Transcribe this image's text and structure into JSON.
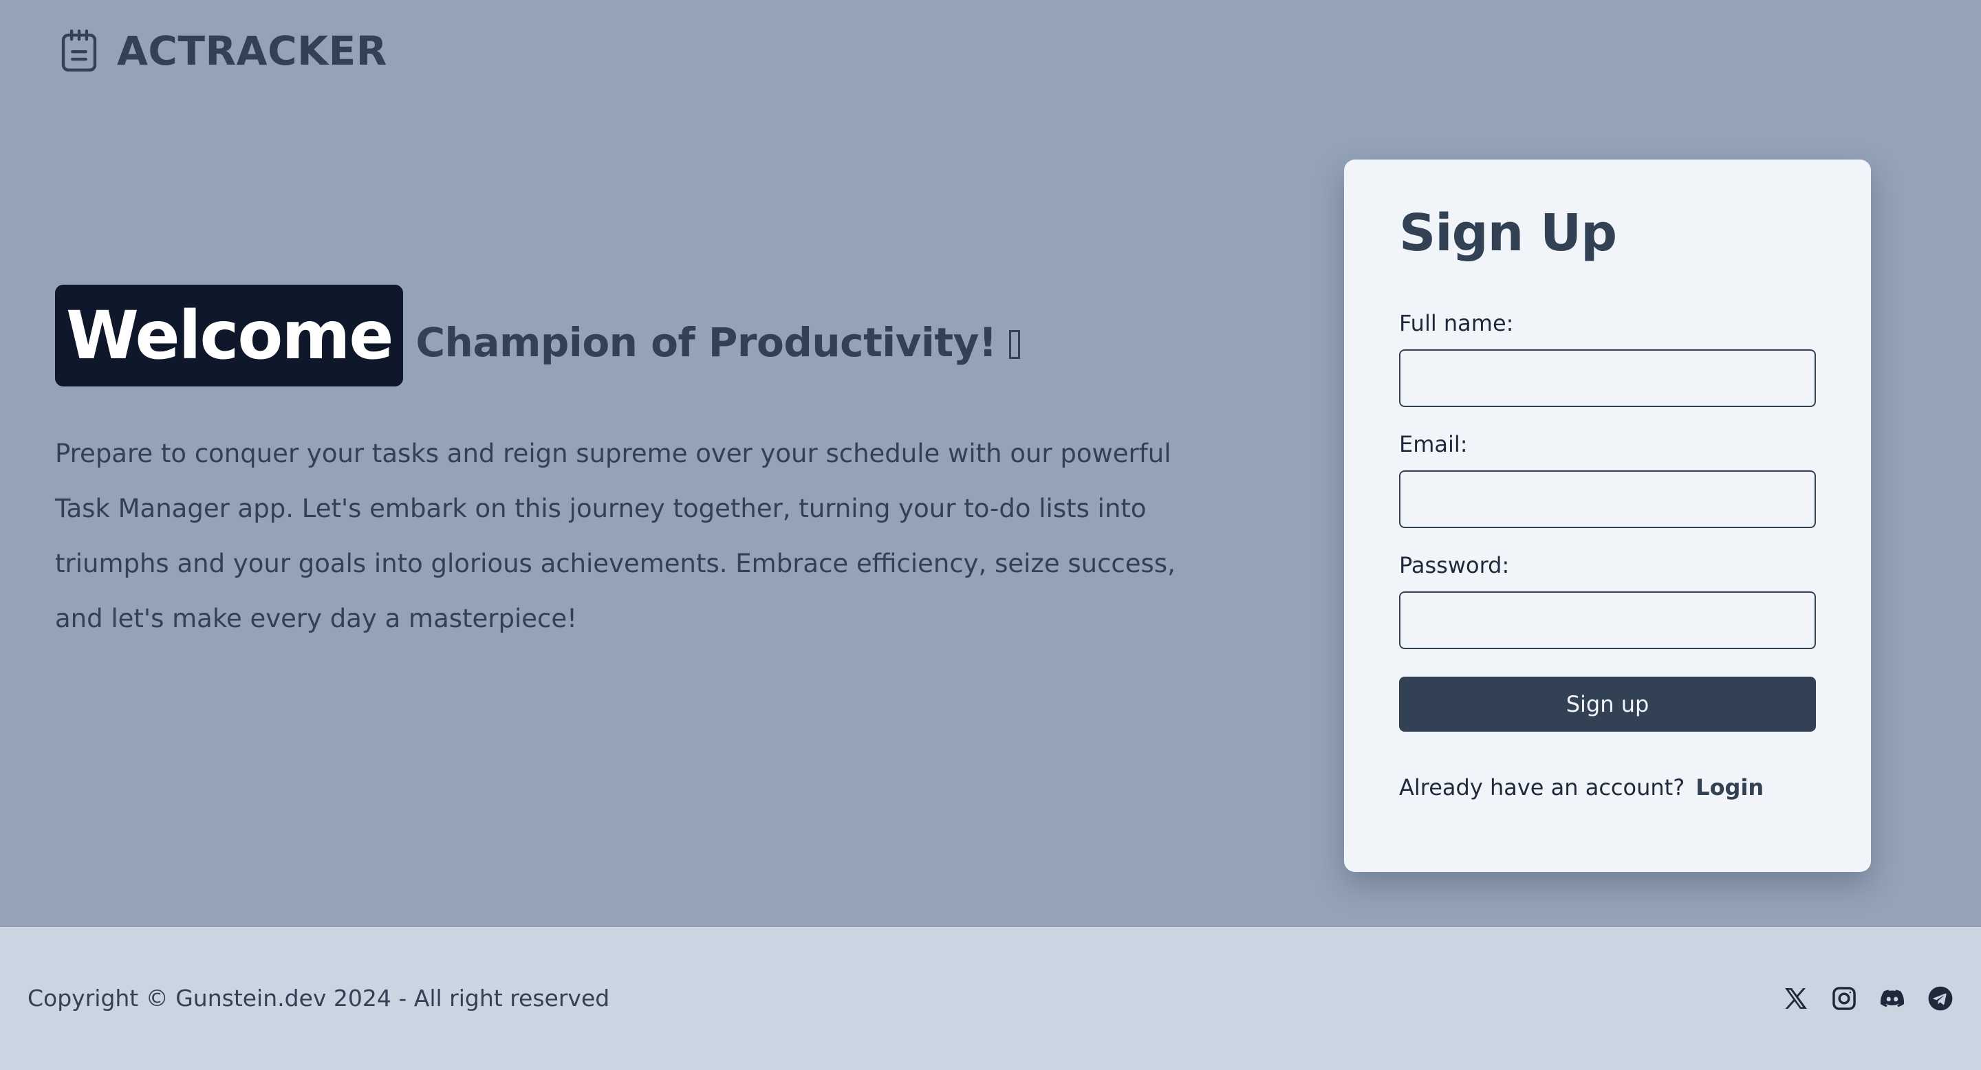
{
  "header": {
    "brand": "ACTRACKER",
    "logo_icon": "clipboard-icon"
  },
  "hero": {
    "welcome": "Welcome",
    "headline": "Champion of Productivity!",
    "intro": "Prepare to conquer your tasks and reign supreme over your schedule with our powerful Task Manager app. Let's embark on this journey together, turning your to-do lists into triumphs and your goals into glorious achievements. Embrace efficiency, seize success, and let's make every day a masterpiece!"
  },
  "signup": {
    "title": "Sign Up",
    "fields": [
      {
        "label": "Full name:",
        "value": "",
        "placeholder": ""
      },
      {
        "label": "Email:",
        "value": "",
        "placeholder": ""
      },
      {
        "label": "Password:",
        "value": "",
        "placeholder": ""
      }
    ],
    "submit_label": "Sign up",
    "login_prompt": "Already have an account?",
    "login_label": "Login"
  },
  "footer": {
    "copyright": "Copyright © Gunstein.dev 2024 - All right reserved",
    "social_icons": [
      "x-icon",
      "instagram-icon",
      "discord-icon",
      "telegram-icon"
    ]
  },
  "colors": {
    "page_background": "#94a3b8",
    "primary": "#334155",
    "dark": "#0f172a",
    "card_background": "#f1f5f9",
    "footer_background": "#cbd5e1"
  }
}
